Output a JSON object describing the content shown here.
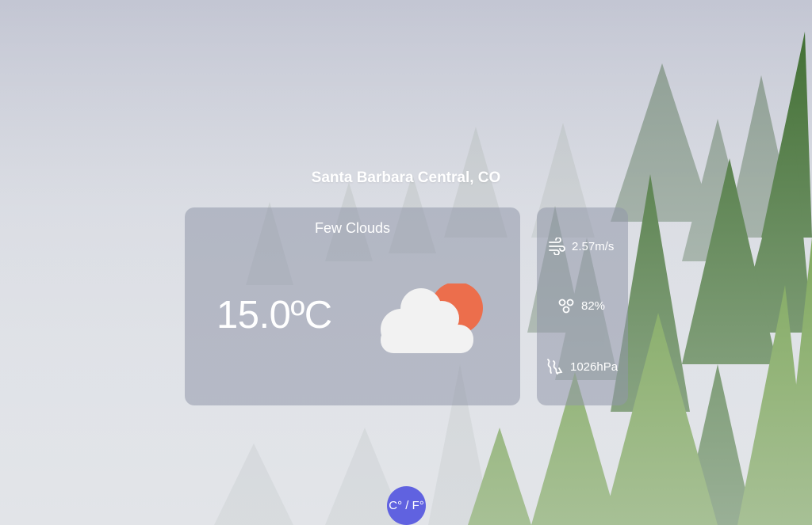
{
  "location": {
    "name": "Santa Barbara Central, CO"
  },
  "current": {
    "condition": "Few Clouds",
    "temperature": "15.0ºC",
    "icon": "few-clouds-icon"
  },
  "details": {
    "wind": {
      "value": "2.57m/s",
      "icon": "wind-icon"
    },
    "humidity": {
      "value": "82%",
      "icon": "humidity-drops-icon"
    },
    "pressure": {
      "value": "1026hPa",
      "icon": "pressure-icon"
    }
  },
  "controls": {
    "unit_toggle_label": "C° / F°"
  },
  "colors": {
    "sun": "#ec6e4c",
    "cloud": "#f2f2f2",
    "toggle": "#6062e0",
    "card": "rgba(145,152,170,0.55)"
  }
}
